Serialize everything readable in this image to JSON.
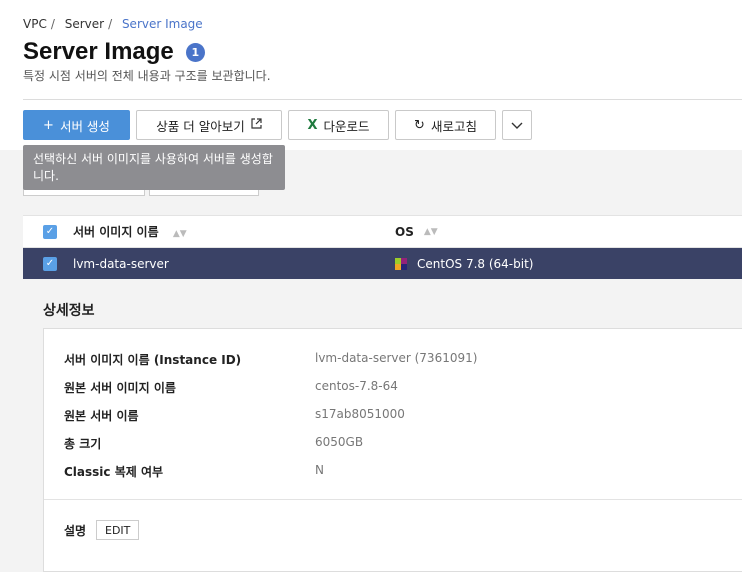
{
  "breadcrumb": [
    "VPC",
    "Server",
    "Server Image"
  ],
  "page": {
    "title": "Server Image",
    "badge": "1",
    "subtitle": "특정 시점 서버의 전체 내용과 구조를 보관합니다."
  },
  "toolbar": {
    "create_label": "서버 생성",
    "info_label": "상품 더 알아보기",
    "download_label": "다운로드",
    "refresh_label": "새로고침"
  },
  "tooltip": "선택하신 서버 이미지를 사용하여 서버를 생성합니다.",
  "table": {
    "headers": [
      "서버 이미지 이름",
      "OS"
    ],
    "rows": [
      {
        "name": "lvm-data-server",
        "os": "CentOS 7.8 (64-bit)"
      }
    ]
  },
  "detail": {
    "title": "상세정보",
    "fields": [
      {
        "key": "서버 이미지 이름 (Instance ID)",
        "value": "lvm-data-server (7361091)"
      },
      {
        "key": "원본 서버 이미지 이름",
        "value": "centos-7.8-64"
      },
      {
        "key": "원본 서버 이름",
        "value": "s17ab8051000"
      },
      {
        "key": "총 크기",
        "value": "6050GB"
      },
      {
        "key": "Classic 복제 여부",
        "value": "N"
      }
    ],
    "description_label": "설명",
    "edit_label": "EDIT"
  },
  "colors": {
    "accent": "#4a74c9",
    "primary_button": "#4a90d9",
    "selected_row": "#3a4266"
  }
}
